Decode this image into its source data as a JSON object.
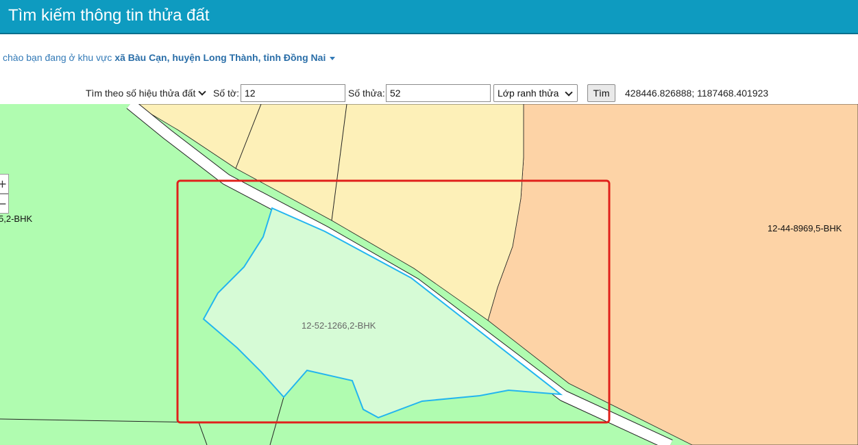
{
  "header": {
    "title": "Tìm kiếm thông tin thửa đất"
  },
  "greeting": {
    "prefix": "chào bạn đang ở khu vực ",
    "location": "xã Bàu Cạn, huyện Long Thành, tỉnh Đồng Nai"
  },
  "search": {
    "mode_label": "Tìm theo số hiệu thửa đất",
    "so_to_label": "Số tờ:",
    "so_to_value": "12",
    "so_thua_label": "Số thửa:",
    "so_thua_value": "52",
    "layer_select": "Lớp ranh thửa",
    "search_button": "Tìm",
    "coordinates": "428446.826888; 1187468.401923"
  },
  "map": {
    "zoom_in": "+",
    "zoom_out": "−",
    "labels": {
      "left_parcel": "5,2-BHK",
      "right_parcel": "12-44-8969,5-BHK",
      "selected_parcel": "12-52-1266,2-BHK"
    },
    "colors": {
      "agri_green": "#b0fcb0",
      "residential_yellow": "#fdf0b8",
      "orange_zone": "#fdd3a6",
      "selected_fill": "#d6fbd6",
      "selected_outline": "#22b5ef",
      "road": "#ffffff",
      "highlight_box": "#e0201b"
    }
  }
}
